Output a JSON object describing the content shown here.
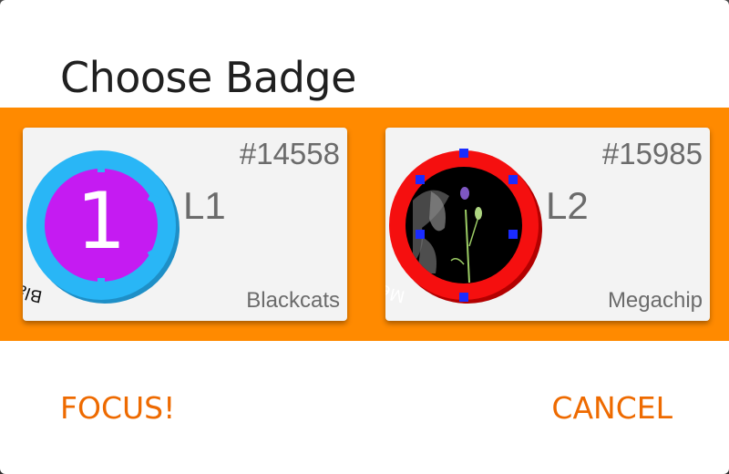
{
  "dialog": {
    "title": "Choose Badge"
  },
  "badges": [
    {
      "number": "#14558",
      "level": "L1",
      "name": "Blackcats",
      "emblem_text": "1",
      "ring_color": "#29b6f6",
      "inner_color": "#c51bf2"
    },
    {
      "number": "#15985",
      "level": "L2",
      "name": "Megachip",
      "emblem_text": "",
      "ring_color": "#f50f0f",
      "inner_color": "#000000"
    }
  ],
  "actions": {
    "focus_label": "FOCUS!",
    "cancel_label": "CANCEL"
  },
  "colors": {
    "accent": "#ee6a00",
    "strip": "#ff8a00"
  }
}
